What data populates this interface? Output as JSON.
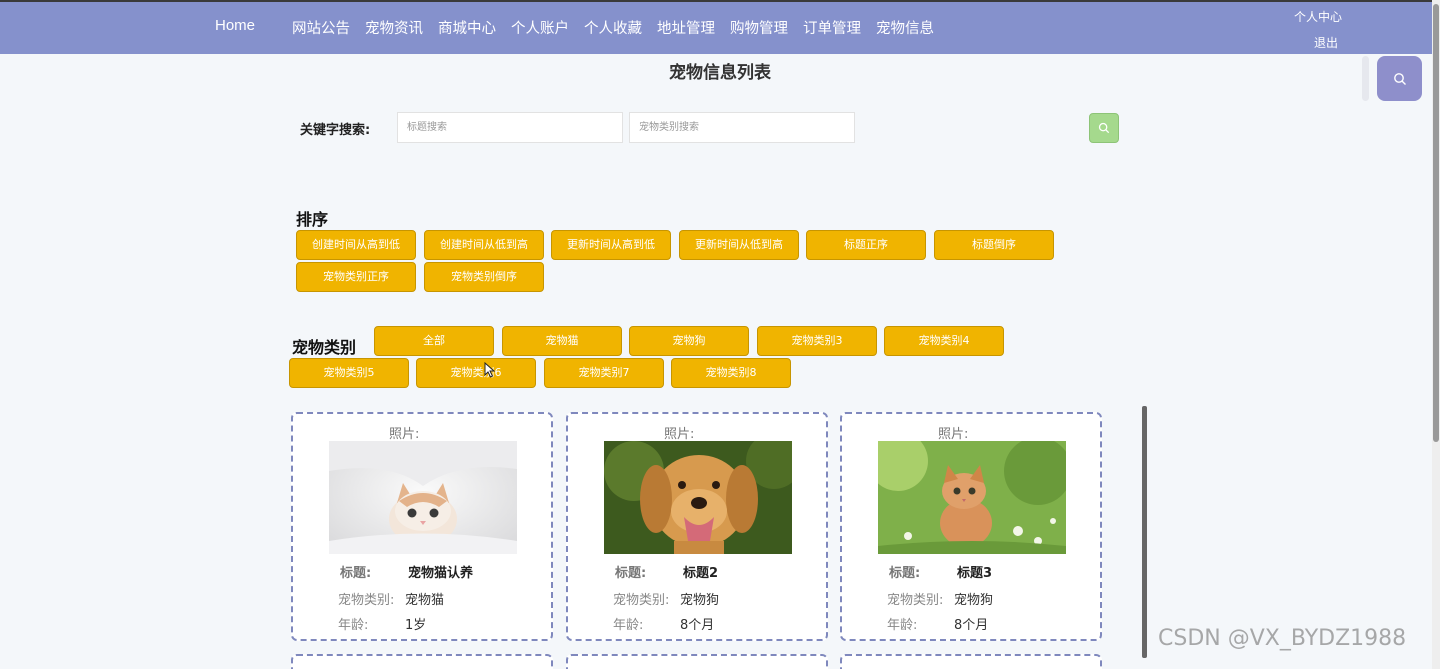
{
  "nav": {
    "home": "Home",
    "items": [
      "网站公告",
      "宠物资讯",
      "商城中心",
      "个人账户",
      "个人收藏",
      "地址管理",
      "购物管理",
      "订单管理",
      "宠物信息"
    ],
    "user_center": "个人中心",
    "logout": "退出"
  },
  "page_title": "宠物信息列表",
  "search": {
    "label": "关键字搜索:",
    "title_placeholder": "标题搜索",
    "category_placeholder": "宠物类别搜索"
  },
  "sort": {
    "title": "排序",
    "buttons": [
      "创建时间从高到低",
      "创建时间从低到高",
      "更新时间从高到低",
      "更新时间从低到高",
      "标题正序",
      "标题倒序",
      "宠物类别正序",
      "宠物类别倒序"
    ]
  },
  "category": {
    "title": "宠物类别",
    "buttons": [
      "全部",
      "宠物猫",
      "宠物狗",
      "宠物类别3",
      "宠物类别4",
      "宠物类别5",
      "宠物类别6",
      "宠物类别7",
      "宠物类别8"
    ]
  },
  "cards": [
    {
      "photo_label": "照片:",
      "title_label": "标题:",
      "title": "宠物猫认养",
      "category_label": "宠物类别:",
      "category": "宠物猫",
      "age_label": "年龄:",
      "age": "1岁"
    },
    {
      "photo_label": "照片:",
      "title_label": "标题:",
      "title": "标题2",
      "category_label": "宠物类别:",
      "category": "宠物狗",
      "age_label": "年龄:",
      "age": "8个月"
    },
    {
      "photo_label": "照片:",
      "title_label": "标题:",
      "title": "标题3",
      "category_label": "宠物类别:",
      "category": "宠物狗",
      "age_label": "年龄:",
      "age": "8个月"
    }
  ],
  "watermark": "CSDN @VX_BYDZ1988",
  "colors": {
    "nav_bg": "#8591cc",
    "button_yellow": "#f0b400",
    "search_green": "#a5d98d",
    "card_border": "#7f88bd"
  }
}
